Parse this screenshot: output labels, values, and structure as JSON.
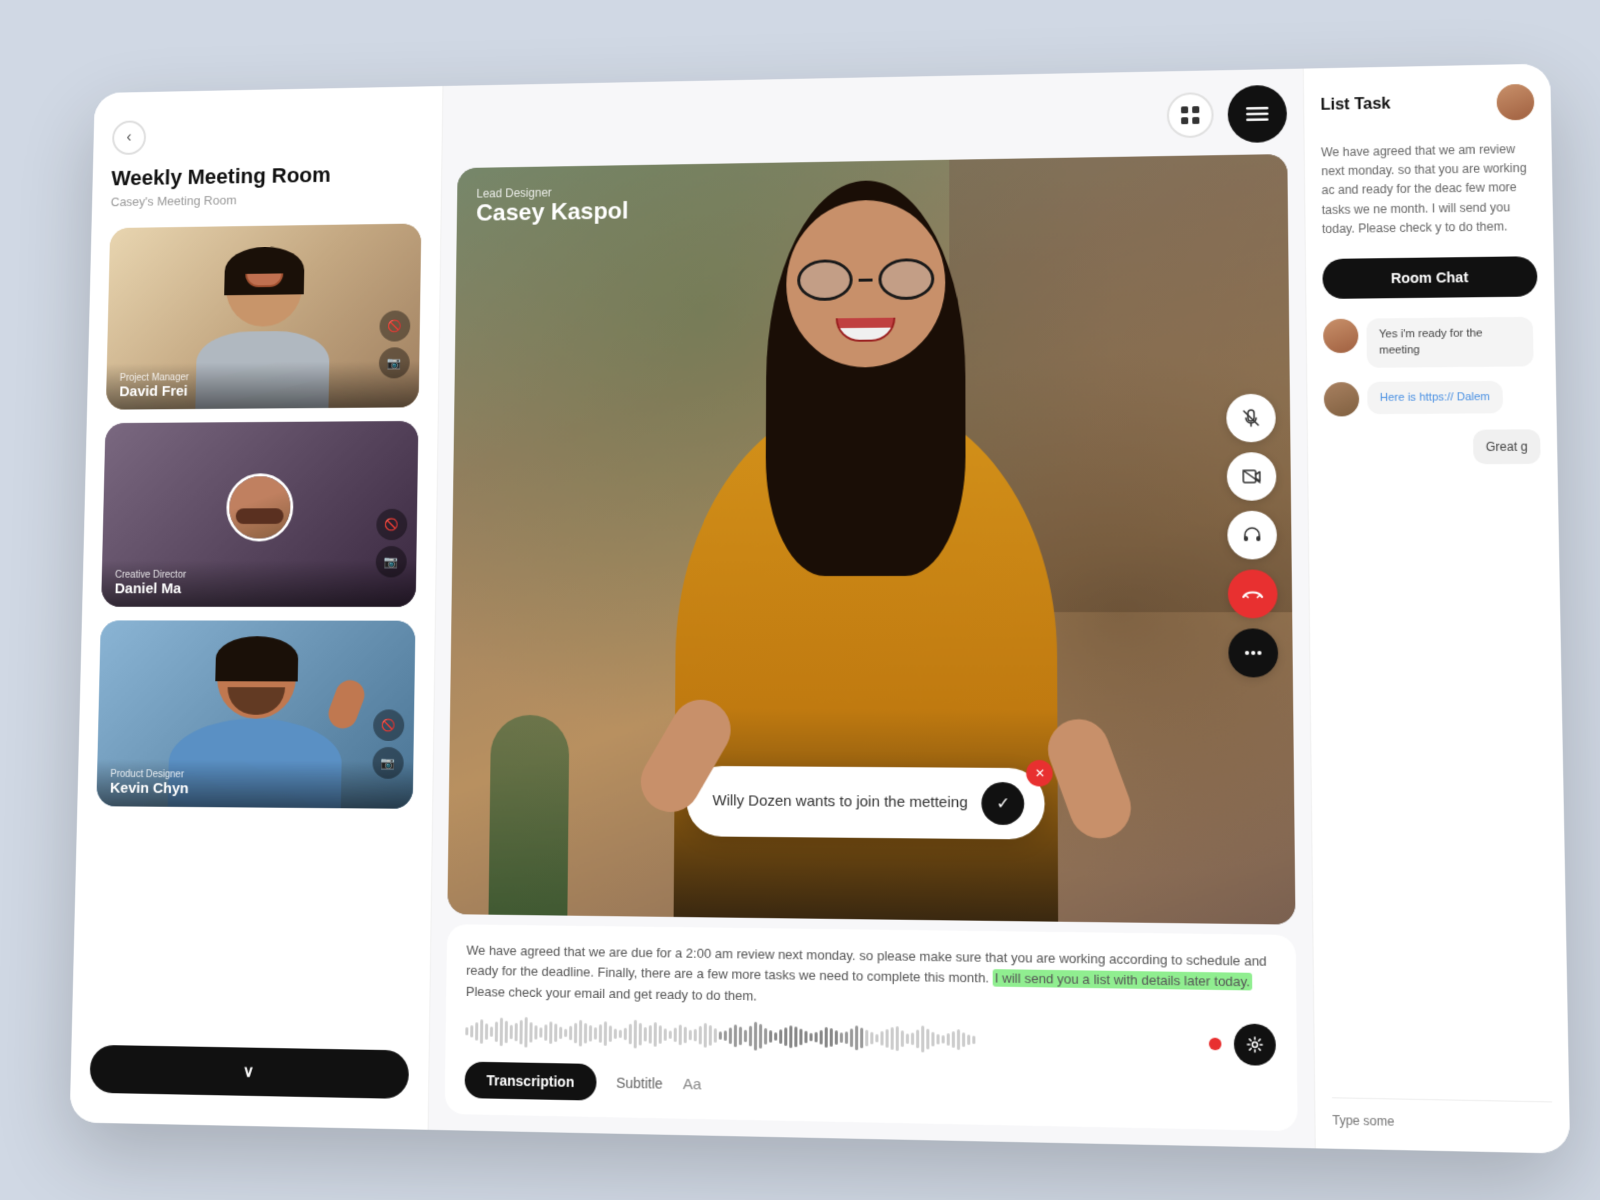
{
  "header": {
    "back_label": "‹",
    "title": "Weekly Meeting Room",
    "subtitle": "Casey's Meeting Room"
  },
  "participants": [
    {
      "id": "david",
      "role": "Project Manager",
      "name": "David Frei",
      "color_class": "card-david"
    },
    {
      "id": "daniel",
      "role": "Creative Director",
      "name": "Daniel Ma",
      "color_class": "card-daniel"
    },
    {
      "id": "kevin",
      "role": "Product Designer",
      "name": "Kevin Chyn",
      "color_class": "card-kevin"
    }
  ],
  "main_video": {
    "role": "Lead Designer",
    "name": "Casey Kaspol"
  },
  "join_notification": {
    "text": "Willy Dozen wants to join the metteing"
  },
  "transcript": {
    "text_before": "We have agreed that we are due for a 2:00 am review next monday. so please make sure that you are working according to schedule and ready for the deadline. Finally, there are a few more tasks we need to complete this month. ",
    "highlighted": "I will send you a list with details later today.",
    "text_after": " Please check your email and get ready to do them."
  },
  "tabs": {
    "active": "Transcription",
    "inactive": "Subtitle",
    "font_label": "Aa"
  },
  "right_panel": {
    "list_task_title": "List Task",
    "task_text": "We have agreed that we am review next monday. so that you are working ac and ready for the deac few more tasks we ne month. I will send you today. Please check y to do them.",
    "room_chat_label": "Room Chat",
    "messages": [
      {
        "id": "msg1",
        "text": "Yes i'm ready for the meeting"
      },
      {
        "id": "msg2",
        "text": "Here is https:// Dalem"
      },
      {
        "id": "msg3",
        "text": "Great g"
      }
    ],
    "input_placeholder": "Type some",
    "chat_input_placeholder": "Type some"
  },
  "controls": {
    "mute_label": "🎤",
    "camera_label": "📷",
    "headset_label": "🎧",
    "hangup_label": "📵",
    "more_label": "•••"
  }
}
